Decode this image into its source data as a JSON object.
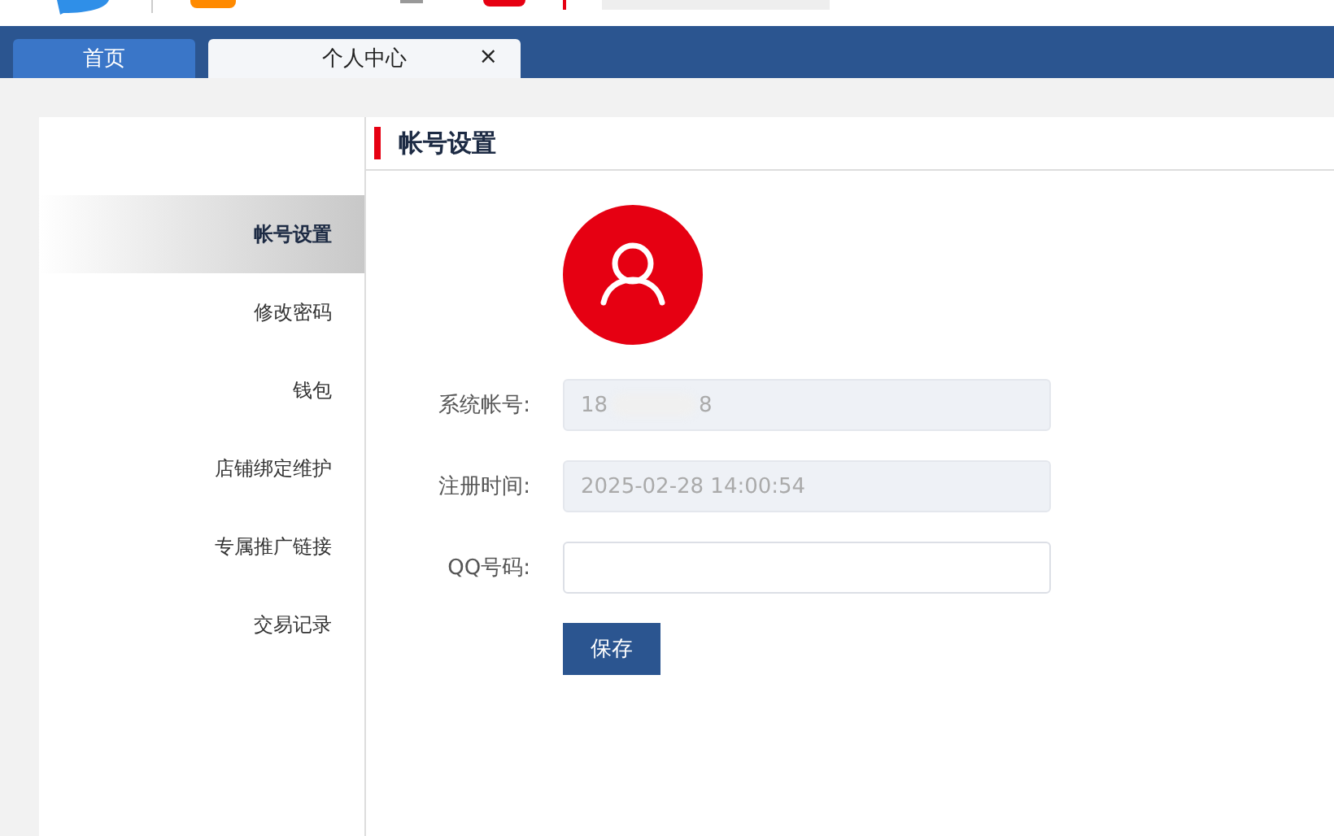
{
  "tabs": [
    {
      "label": "首页",
      "selected": false
    },
    {
      "label": "个人中心",
      "selected": true,
      "close_glyph": "×"
    }
  ],
  "sidebar": {
    "items": [
      {
        "label": "帐号设置",
        "selected": true
      },
      {
        "label": "修改密码",
        "selected": false
      },
      {
        "label": "钱包",
        "selected": false
      },
      {
        "label": "店铺绑定维护",
        "selected": false
      },
      {
        "label": "专属推广链接",
        "selected": false
      },
      {
        "label": "交易记录",
        "selected": false
      }
    ]
  },
  "panel": {
    "title": "帐号设置"
  },
  "form": {
    "fields": [
      {
        "label": "系统帐号:",
        "value_start": "18",
        "value_end": "8",
        "obscured": true,
        "disabled": true
      },
      {
        "label": "注册时间:",
        "value": "2025-02-28 14:00:54",
        "disabled": true
      },
      {
        "label": "QQ号码:",
        "disabled": false
      }
    ],
    "button": "保存"
  }
}
